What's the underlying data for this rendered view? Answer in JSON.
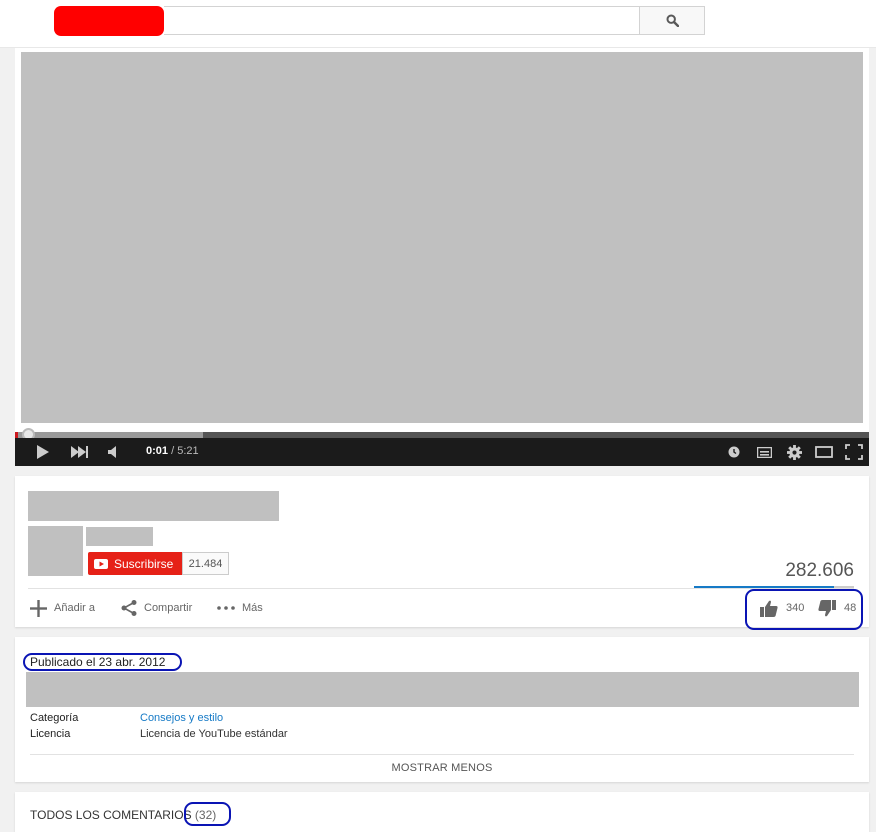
{
  "header": {
    "search_placeholder": "",
    "search_icon": "search-icon"
  },
  "player": {
    "time_current": "0:01",
    "time_separator": " / ",
    "time_total": "5:21",
    "progress_played": 0.003,
    "progress_loaded": 0.22,
    "accent_color": "#cc181e",
    "icons": [
      "play-icon",
      "next-icon",
      "volume-icon",
      "watch-later-icon",
      "subtitles-icon",
      "settings-icon",
      "theater-mode-icon",
      "fullscreen-icon"
    ]
  },
  "video_info": {
    "subscribe_label": "Suscribirse",
    "subscriber_count": "21.484",
    "view_count": "282.606",
    "actions": {
      "add_to": "Añadir a",
      "share": "Compartir",
      "more": "Más"
    },
    "likes": "340",
    "dislikes": "48",
    "like_ratio": 0.876
  },
  "description": {
    "published": "Publicado el 23 abr. 2012",
    "category_label": "Categoría",
    "category_value": "Consejos y estilo",
    "license_label": "Licencia",
    "license_value": "Licencia de YouTube estándar",
    "show_less": "MOSTRAR MENOS"
  },
  "comments": {
    "title": "TODOS LOS COMENTARIOS",
    "count": "(32)"
  },
  "colors": {
    "highlight": "#0a14b4",
    "link": "#167ac6",
    "subscribe": "#e62117"
  }
}
